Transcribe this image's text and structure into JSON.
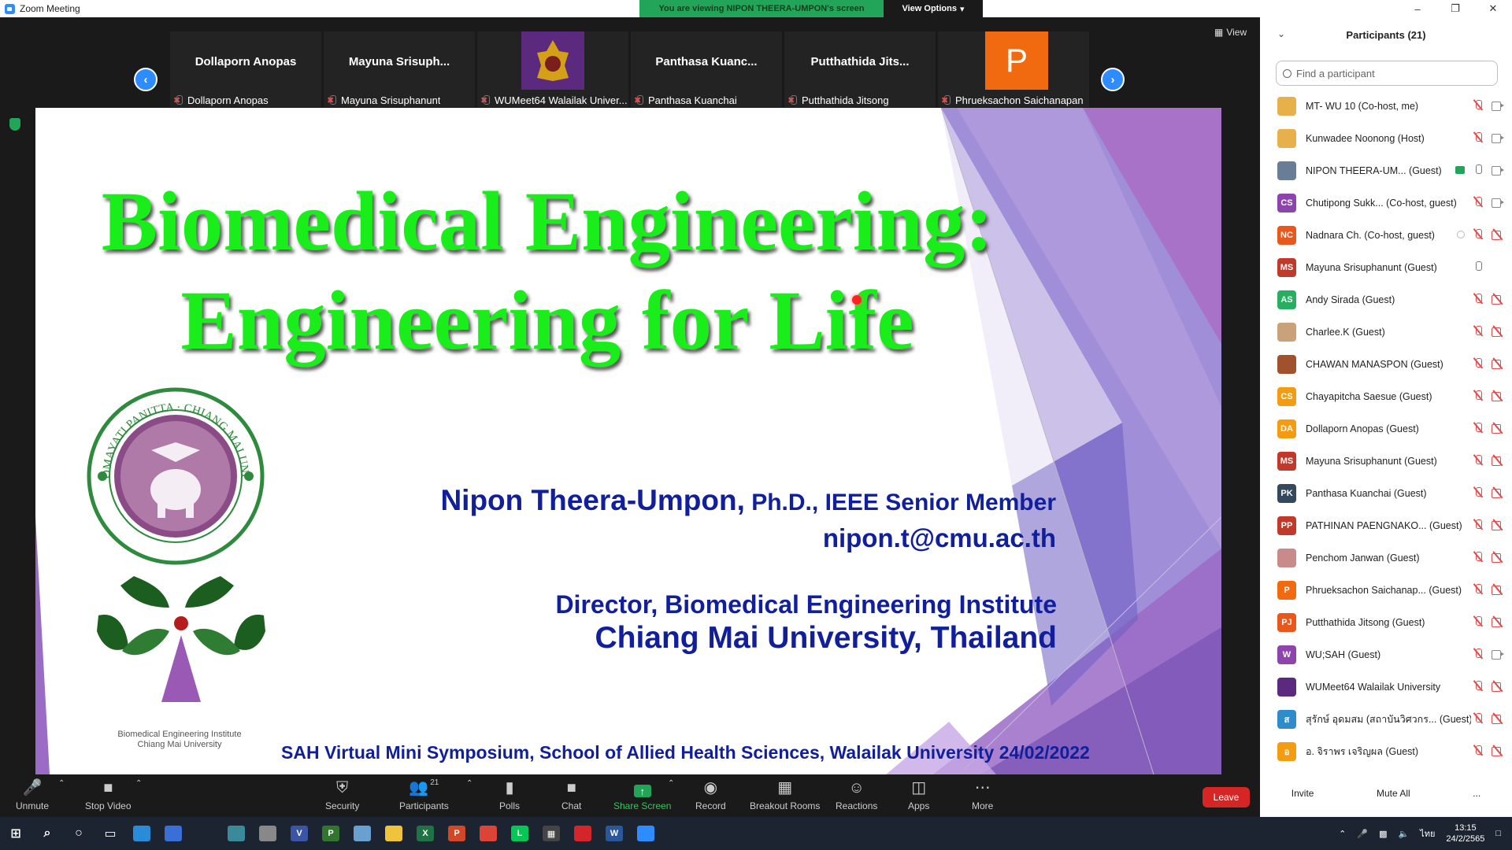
{
  "window": {
    "title": "Zoom Meeting"
  },
  "banner": {
    "viewing": "You are viewing NIPON THEERA-UMPON's screen",
    "view_options": "View Options"
  },
  "view_btn": "View",
  "gallery": [
    {
      "name": "Dollaporn Anopas",
      "label": "Dollaporn Anopas",
      "type": "name"
    },
    {
      "name": "Mayuna  Srisuph...",
      "label": "Mayuna Srisuphanunt",
      "type": "name"
    },
    {
      "name": "",
      "label": "WUMeet64 Walailak Univer...",
      "type": "image"
    },
    {
      "name": "Panthasa  Kuanc...",
      "label": "Panthasa Kuanchai",
      "type": "name"
    },
    {
      "name": "Putthathida  Jits...",
      "label": "Putthathida Jitsong",
      "type": "name"
    },
    {
      "name": "P",
      "label": "Phrueksachon Saichanapan",
      "type": "letter"
    }
  ],
  "slide": {
    "title_line1": "Biomedical Engineering:",
    "title_line2": "Engineering for Life",
    "presenter_name": "Nipon Theera-Umpon,",
    "presenter_cred": " Ph.D., IEEE Senior Member",
    "email": "nipon.t@cmu.ac.th",
    "director": "Director, Biomedical Engineering Institute",
    "university": "Chiang Mai University, Thailand",
    "symposium": "SAH Virtual Mini Symposium, School of Allied Health Sciences, Walailak University  24/02/2022",
    "logo_caption1": "Biomedical Engineering Institute",
    "logo_caption2": "Chiang Mai University",
    "seal_text": "ATTANUNG DOMAYATI PANITTA · CHIANG MAI UNIVERSITY 1964"
  },
  "toolbar": {
    "unmute": "Unmute",
    "stop_video": "Stop Video",
    "security": "Security",
    "participants": "Participants",
    "participants_count": "21",
    "polls": "Polls",
    "chat": "Chat",
    "share_screen": "Share Screen",
    "record": "Record",
    "breakout": "Breakout Rooms",
    "reactions": "Reactions",
    "apps": "Apps",
    "more": "More",
    "leave": "Leave"
  },
  "panel": {
    "title": "Participants (21)",
    "search_placeholder": "Find a participant",
    "participants": [
      {
        "name": "MT- WU 10 (Co-host, me)",
        "initials": "",
        "color": "#e8b04a",
        "mic": "muted",
        "cam": "on"
      },
      {
        "name": "Kunwadee Noonong (Host)",
        "initials": "",
        "color": "#e8b04a",
        "mic": "muted",
        "cam": "on"
      },
      {
        "name": "NIPON THEERA-UM...  (Guest)",
        "initials": "",
        "color": "#6a7d96",
        "mic": "on",
        "cam": "on",
        "share": true
      },
      {
        "name": "Chutipong Sukk...  (Co-host, guest)",
        "initials": "CS",
        "color": "#8e44ad",
        "mic": "muted",
        "cam": "on"
      },
      {
        "name": "Nadnara Ch. (Co-host, guest)",
        "initials": "NC",
        "color": "#e8571b",
        "mic": "muted",
        "cam": "off",
        "rec": true
      },
      {
        "name": "Mayuna Srisuphanunt (Guest)",
        "initials": "MS",
        "color": "#c0392b",
        "mic": "on",
        "cam": "none"
      },
      {
        "name": "Andy Sirada (Guest)",
        "initials": "AS",
        "color": "#27ae60",
        "mic": "muted",
        "cam": "off"
      },
      {
        "name": "Charlee.K (Guest)",
        "initials": "",
        "color": "#c9a27a",
        "mic": "muted",
        "cam": "off"
      },
      {
        "name": "CHAWAN MANASPON (Guest)",
        "initials": "",
        "color": "#a0522d",
        "mic": "muted",
        "cam": "off"
      },
      {
        "name": "Chayapitcha Saesue (Guest)",
        "initials": "CS",
        "color": "#f39c12",
        "mic": "muted",
        "cam": "off"
      },
      {
        "name": "Dollaporn Anopas (Guest)",
        "initials": "DA",
        "color": "#f39c12",
        "mic": "muted",
        "cam": "off"
      },
      {
        "name": "Mayuna Srisuphanunt (Guest)",
        "initials": "MS",
        "color": "#c0392b",
        "mic": "muted",
        "cam": "off"
      },
      {
        "name": "Panthasa Kuanchai (Guest)",
        "initials": "PK",
        "color": "#34495e",
        "mic": "muted",
        "cam": "off"
      },
      {
        "name": "PATHINAN PAENGNAKO...  (Guest)",
        "initials": "PP",
        "color": "#c0392b",
        "mic": "muted",
        "cam": "off"
      },
      {
        "name": "Penchom Janwan (Guest)",
        "initials": "",
        "color": "#c98a8a",
        "mic": "muted",
        "cam": "off"
      },
      {
        "name": "Phrueksachon Saichanap...  (Guest)",
        "initials": "P",
        "color": "#f26a10",
        "mic": "muted",
        "cam": "off"
      },
      {
        "name": "Putthathida Jitsong (Guest)",
        "initials": "PJ",
        "color": "#e8571b",
        "mic": "muted",
        "cam": "off"
      },
      {
        "name": "WU;SAH (Guest)",
        "initials": "W",
        "color": "#8e44ad",
        "mic": "muted",
        "cam": "on"
      },
      {
        "name": "WUMeet64 Walailak University",
        "initials": "",
        "color": "#5b2a7e",
        "mic": "muted",
        "cam": "off"
      },
      {
        "name": "สุรักษ์ อุดมสม (สถาบันวิศวกร...  (Guest)",
        "initials": "ส",
        "color": "#2d8cc9",
        "mic": "muted",
        "cam": "off"
      },
      {
        "name": "อ. จิราพร  เจริญผล (Guest)",
        "initials": "อ",
        "color": "#f39c12",
        "mic": "muted",
        "cam": "off"
      }
    ],
    "invite": "Invite",
    "mute_all": "Mute All",
    "more": "..."
  },
  "taskbar": {
    "time": "13:15",
    "date": "24/2/2565",
    "lang": "ไทย",
    "apps": [
      "windows-start",
      "search",
      "cortana",
      "task-view",
      "edge",
      "store",
      "mail",
      "app-mapper",
      "app-tool",
      "visio",
      "project",
      "app-notes",
      "explorer",
      "excel",
      "powerpoint",
      "chrome",
      "line",
      "calculator",
      "acrobat",
      "word",
      "zoom"
    ]
  }
}
